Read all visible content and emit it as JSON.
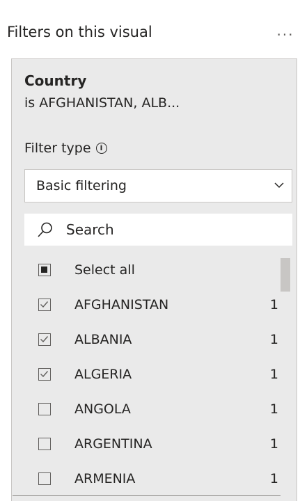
{
  "header": {
    "title": "Filters on this visual",
    "more_label": "..."
  },
  "filter_card": {
    "field_name": "Country",
    "summary": "is AFGHANISTAN, ALB...",
    "filter_type_label": "Filter type",
    "info_glyph": "i",
    "filter_type_value": "Basic filtering",
    "search_placeholder": "Search",
    "items": [
      {
        "label": "Select all",
        "count": "",
        "state": "partial"
      },
      {
        "label": "AFGHANISTAN",
        "count": "1",
        "state": "checked"
      },
      {
        "label": "ALBANIA",
        "count": "1",
        "state": "checked"
      },
      {
        "label": "ALGERIA",
        "count": "1",
        "state": "checked"
      },
      {
        "label": "ANGOLA",
        "count": "1",
        "state": "unchecked"
      },
      {
        "label": "ARGENTINA",
        "count": "1",
        "state": "unchecked"
      },
      {
        "label": "ARMENIA",
        "count": "1",
        "state": "unchecked"
      }
    ]
  },
  "icons": {
    "more": "more-options-icon",
    "info": "info-icon",
    "dropdown": "chevron-down-icon",
    "search": "search-icon"
  },
  "colors": {
    "card_background": "#eaeaea",
    "text": "#252423",
    "border": "#c8c6c4"
  }
}
